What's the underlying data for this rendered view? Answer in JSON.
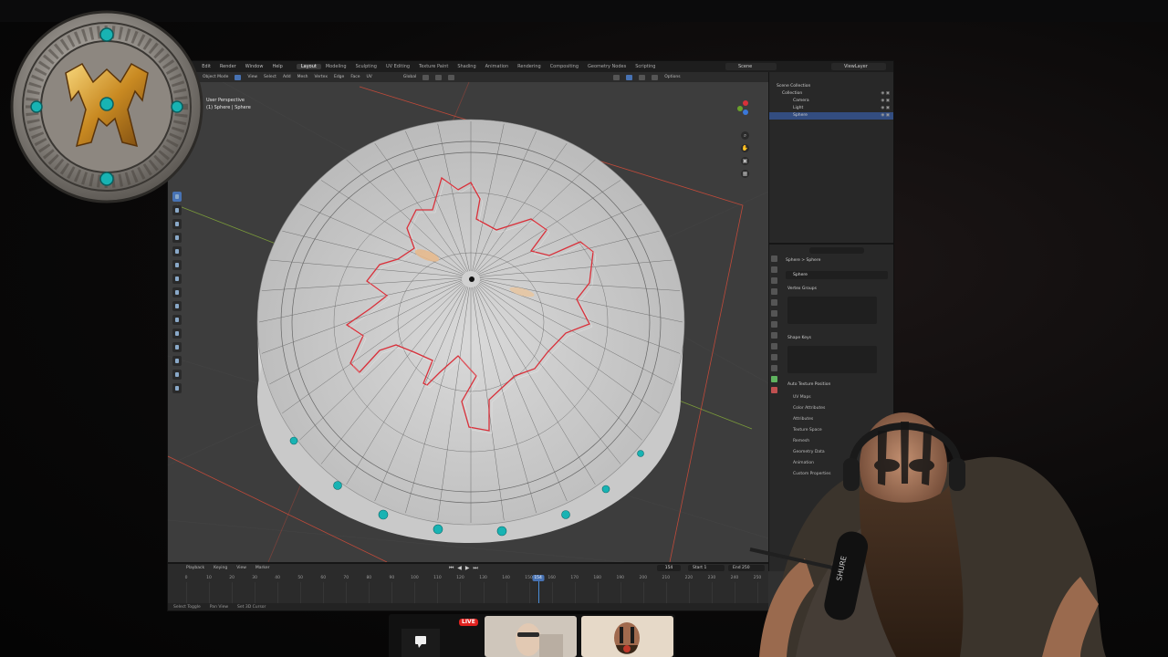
{
  "colors": {
    "accent": "#4772b3",
    "live": "#e0221f",
    "selection_outline": "#d9303a",
    "gem": "#18b3b3"
  },
  "blender": {
    "menu": [
      "File",
      "Edit",
      "Render",
      "Window",
      "Help"
    ],
    "workspaces": [
      "Layout",
      "Modeling",
      "Sculpting",
      "UV Editing",
      "Texture Paint",
      "Shading",
      "Animation",
      "Rendering",
      "Compositing",
      "Geometry Nodes",
      "Scripting"
    ],
    "active_workspace": "Layout",
    "scene": "Scene",
    "view_layer": "ViewLayer",
    "viewport_header": {
      "mode": "Object Mode",
      "menus": [
        "View",
        "Select",
        "Add",
        "Mesh",
        "Vertex",
        "Edge",
        "Face",
        "UV"
      ],
      "transform": "Global",
      "options": "Options"
    },
    "viewport": {
      "line1": "User Perspective",
      "line2": "(1) Sphere | Sphere"
    },
    "outliner": {
      "root": "Scene Collection",
      "collection": "Collection",
      "items": [
        "Camera",
        "Light",
        "Sphere"
      ],
      "selected": "Sphere"
    },
    "properties": {
      "breadcrumb": "Sphere  >  Sphere",
      "object_name": "Sphere",
      "vertex_groups": "Vertex Groups",
      "shape_keys": "Shape Keys",
      "auto_texture_space": "Auto Texture Position",
      "subpanels": [
        "UV Maps",
        "Color Attributes",
        "Attributes",
        "Texture Space",
        "Remesh",
        "Geometry Data",
        "Animation",
        "Custom Properties"
      ]
    },
    "timeline": {
      "menus": [
        "Playback",
        "Keying",
        "View",
        "Marker"
      ],
      "current_frame": "154",
      "frame_display": "154",
      "start_label": "Start",
      "start": "1",
      "end_label": "End",
      "end": "250",
      "ticks": [
        "0",
        "10",
        "20",
        "30",
        "40",
        "50",
        "60",
        "70",
        "80",
        "90",
        "100",
        "110",
        "120",
        "130",
        "140",
        "150",
        "160",
        "170",
        "180",
        "190",
        "200",
        "210",
        "220",
        "230",
        "240",
        "250"
      ]
    },
    "status": [
      "Select Toggle",
      "Pan View",
      "Set 3D Cursor"
    ]
  },
  "stream": {
    "live_label": "LIVE"
  }
}
